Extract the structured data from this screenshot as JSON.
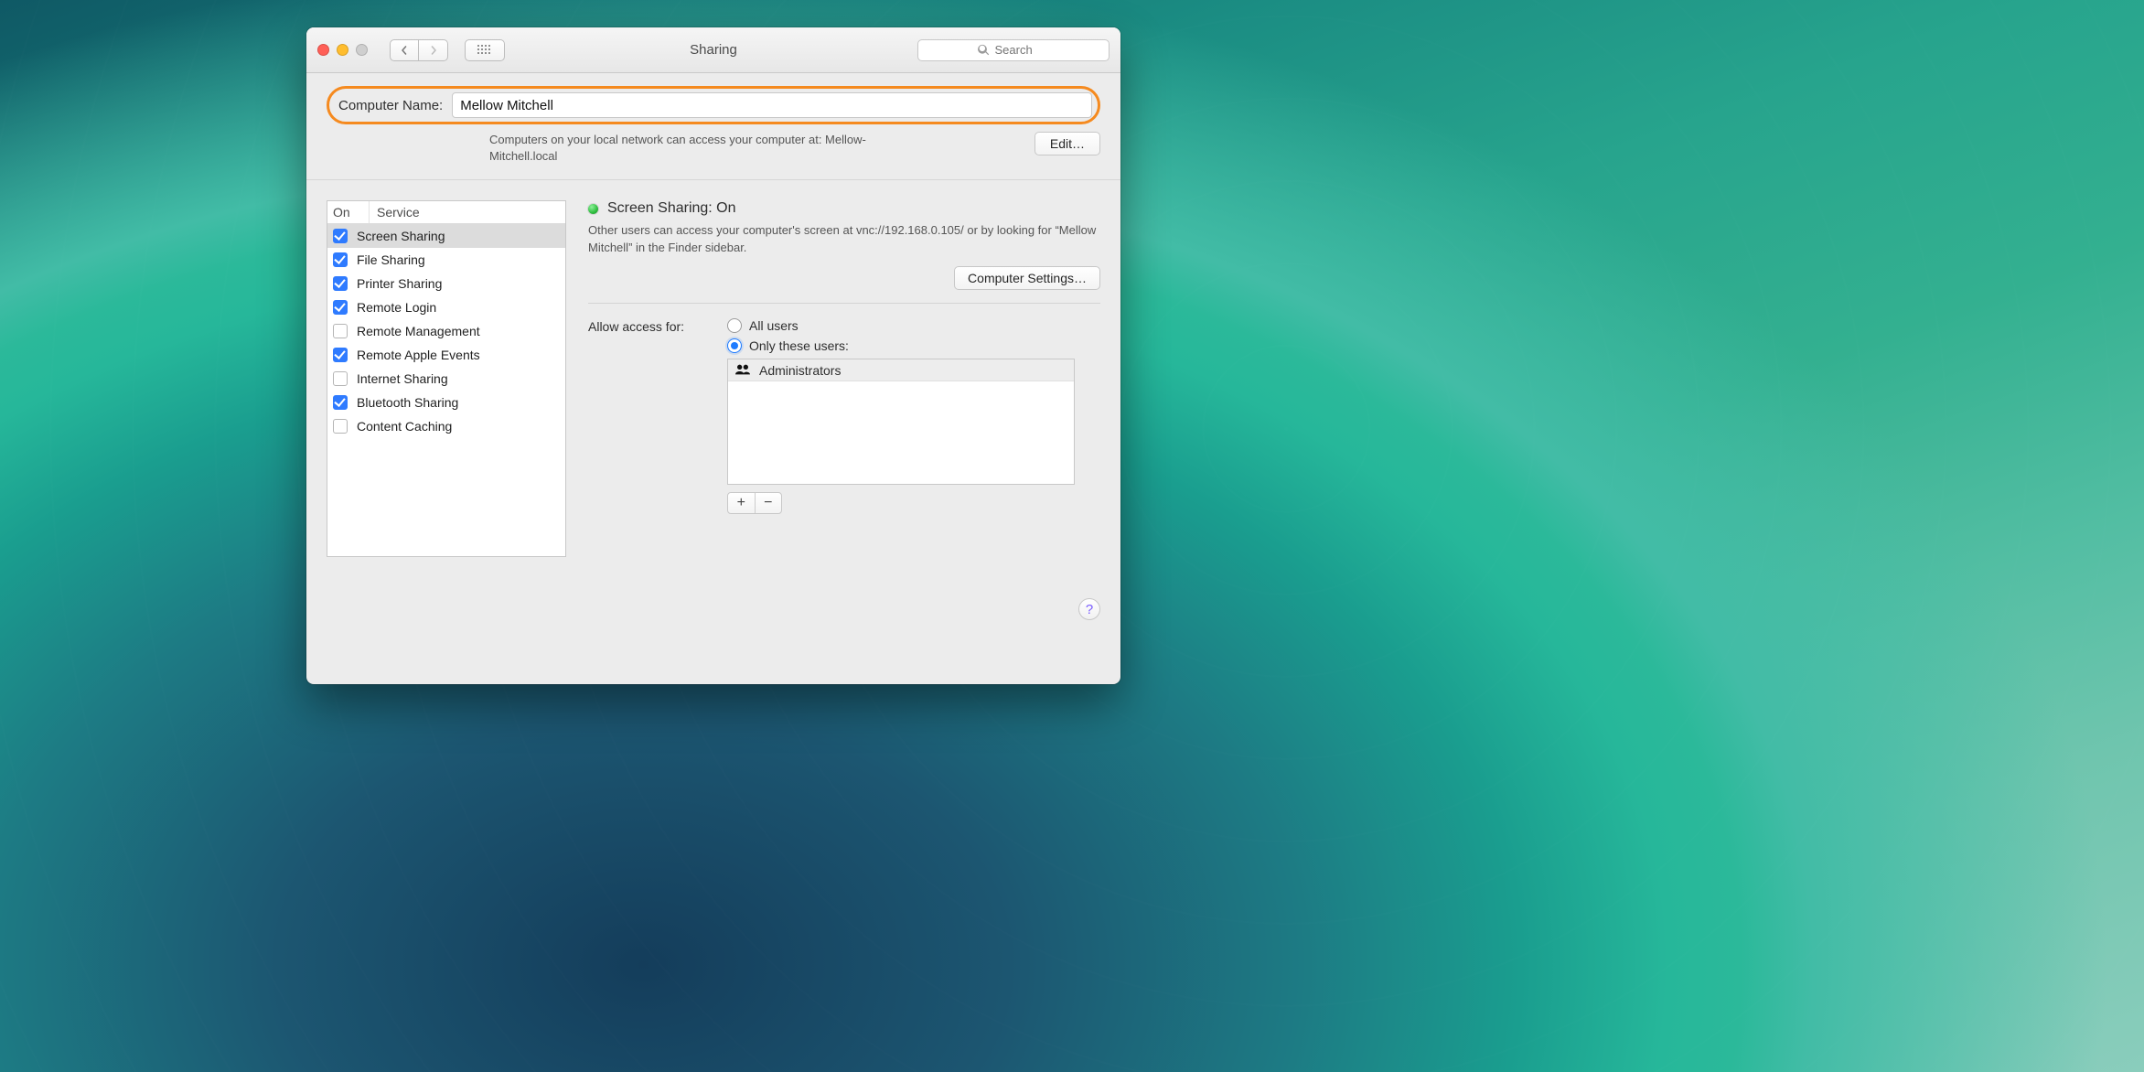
{
  "window": {
    "title": "Sharing",
    "search_placeholder": "Search"
  },
  "header": {
    "computer_name_label": "Computer Name:",
    "computer_name_value": "Mellow Mitchell",
    "network_text": "Computers on your local network can access your computer at: Mellow-Mitchell.local",
    "edit_button": "Edit…"
  },
  "services": {
    "col_on": "On",
    "col_service": "Service",
    "items": [
      {
        "label": "Screen Sharing",
        "on": true,
        "selected": true
      },
      {
        "label": "File Sharing",
        "on": true,
        "selected": false
      },
      {
        "label": "Printer Sharing",
        "on": true,
        "selected": false
      },
      {
        "label": "Remote Login",
        "on": true,
        "selected": false
      },
      {
        "label": "Remote Management",
        "on": false,
        "selected": false
      },
      {
        "label": "Remote Apple Events",
        "on": true,
        "selected": false
      },
      {
        "label": "Internet Sharing",
        "on": false,
        "selected": false
      },
      {
        "label": "Bluetooth Sharing",
        "on": true,
        "selected": false
      },
      {
        "label": "Content Caching",
        "on": false,
        "selected": false
      }
    ]
  },
  "detail": {
    "status_label": "Screen Sharing: On",
    "description": "Other users can access your computer's screen at vnc://192.168.0.105/ or by looking for “Mellow Mitchell” in the Finder sidebar.",
    "computer_settings_button": "Computer Settings…",
    "access_label": "Allow access for:",
    "radio_all": "All users",
    "radio_only": "Only these users:",
    "selected_radio": "only",
    "users": [
      "Administrators"
    ]
  }
}
